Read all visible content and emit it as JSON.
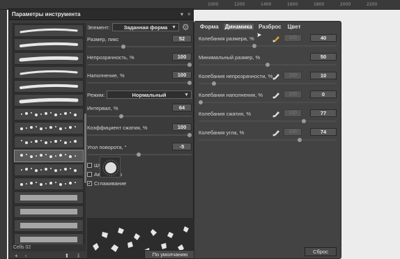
{
  "ruler": {
    "ticks": [
      "1000",
      "1200",
      "1400",
      "1600",
      "1800",
      "2000",
      "2200"
    ]
  },
  "panel": {
    "title": "Параметры инструмента",
    "cells_label": "Cells 02",
    "brushes": [
      "b1",
      "b2",
      "b3",
      "b4",
      "b5",
      "b6",
      "b7",
      "b8",
      "b9",
      "b10",
      "b11",
      "b12",
      "b13",
      "b14",
      "b15",
      "b16"
    ],
    "element_label": "Элемент:",
    "element_value": "Заданная форма",
    "size_label": "Размер, пикс",
    "size_value": "52",
    "opacity_label": "Непрозрачность, %",
    "opacity_value": "100",
    "fill_label": "Наполнение, %",
    "fill_value": "100",
    "mode_label": "Режим:",
    "mode_value": "Нормальный",
    "interval_label": "Интервал, %",
    "interval_value": "64",
    "compress_label": "Коэффициент сжатия, %",
    "compress_value": "100",
    "angle_label": "Угол поворота, °",
    "angle_value": "-5",
    "noise_label": "Шум",
    "autorepeat_label": "Автоповтор",
    "smoothing_label": "Сглаживание",
    "default_button": "По умолчанию",
    "levels": {
      "size": 0.34,
      "opacity": 1.0,
      "fill": 1.0,
      "interval": 0.32,
      "compress": 1.0,
      "angle": 0.49
    }
  },
  "dynamics": {
    "tabs": [
      "Форма",
      "Динамика",
      "Разброс",
      "Цвет"
    ],
    "active_tab": "Динамика",
    "rows": [
      {
        "label": "Колебания размера, %",
        "value": "40",
        "dim": "100",
        "level": 0.4
      },
      {
        "label": "Минимальный размер, %",
        "value": "50",
        "dim": "",
        "level": 0.5
      },
      {
        "label": "Колебания непрозрачности, %",
        "value": "10",
        "dim": "100",
        "level": 0.1
      },
      {
        "label": "Колебания наполнения, %",
        "value": "0",
        "dim": "100",
        "level": 0.0
      },
      {
        "label": "Колебания сжатия, %",
        "value": "77",
        "dim": "100",
        "level": 0.77
      },
      {
        "label": "Колебания угла, %",
        "value": "74",
        "dim": "100",
        "level": 0.74
      }
    ],
    "reset_button": "Сброс"
  }
}
